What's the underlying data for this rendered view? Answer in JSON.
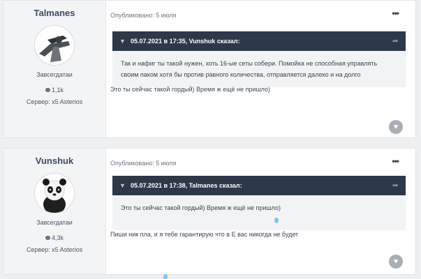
{
  "posts": [
    {
      "author": {
        "name": "Talmanes",
        "rank": "Завсегдатаи",
        "reputation": "1,1k",
        "server": "Сервер: x5 Asterios"
      },
      "meta": "Опубликовано: 5 июля",
      "quote": {
        "header": "05.07.2021 в 17:35, Vunshuk сказал:",
        "lines": [
          "Так и нафиг ты такой нужен, хоть 16-ые сеты собери. Помойка не способная управлять",
          "своим паком хотя бы против равного количества, отправляется далеко и на долго"
        ]
      },
      "text": "Это ты сейчас такой гордый) Время ж ещё не пришло)"
    },
    {
      "author": {
        "name": "Vunshuk",
        "rank": "Завсегдатаи",
        "reputation": "4,3k",
        "server": "Сервер: x5 Asterios"
      },
      "meta": "Опубликовано: 5 июля",
      "quote": {
        "header": "05.07.2021 в 17:38, Talmanes сказал:",
        "lines": [
          "Это ты сейчас такой гордый) Время ж ещё не пришло)"
        ]
      },
      "text": "Пиши ник пла, и я тебе гарантирую что в Е вас никогда не будет"
    }
  ],
  "icons": {
    "more": "ellipsis-icon",
    "chevron": "chevron-down-icon",
    "share": "share-arrow-icon",
    "react": "heart-icon",
    "reputation": "comment-icon"
  },
  "colors": {
    "quote_header": "#2d3849",
    "author_name": "#3d4b5f",
    "react": "#a9aeb6"
  }
}
